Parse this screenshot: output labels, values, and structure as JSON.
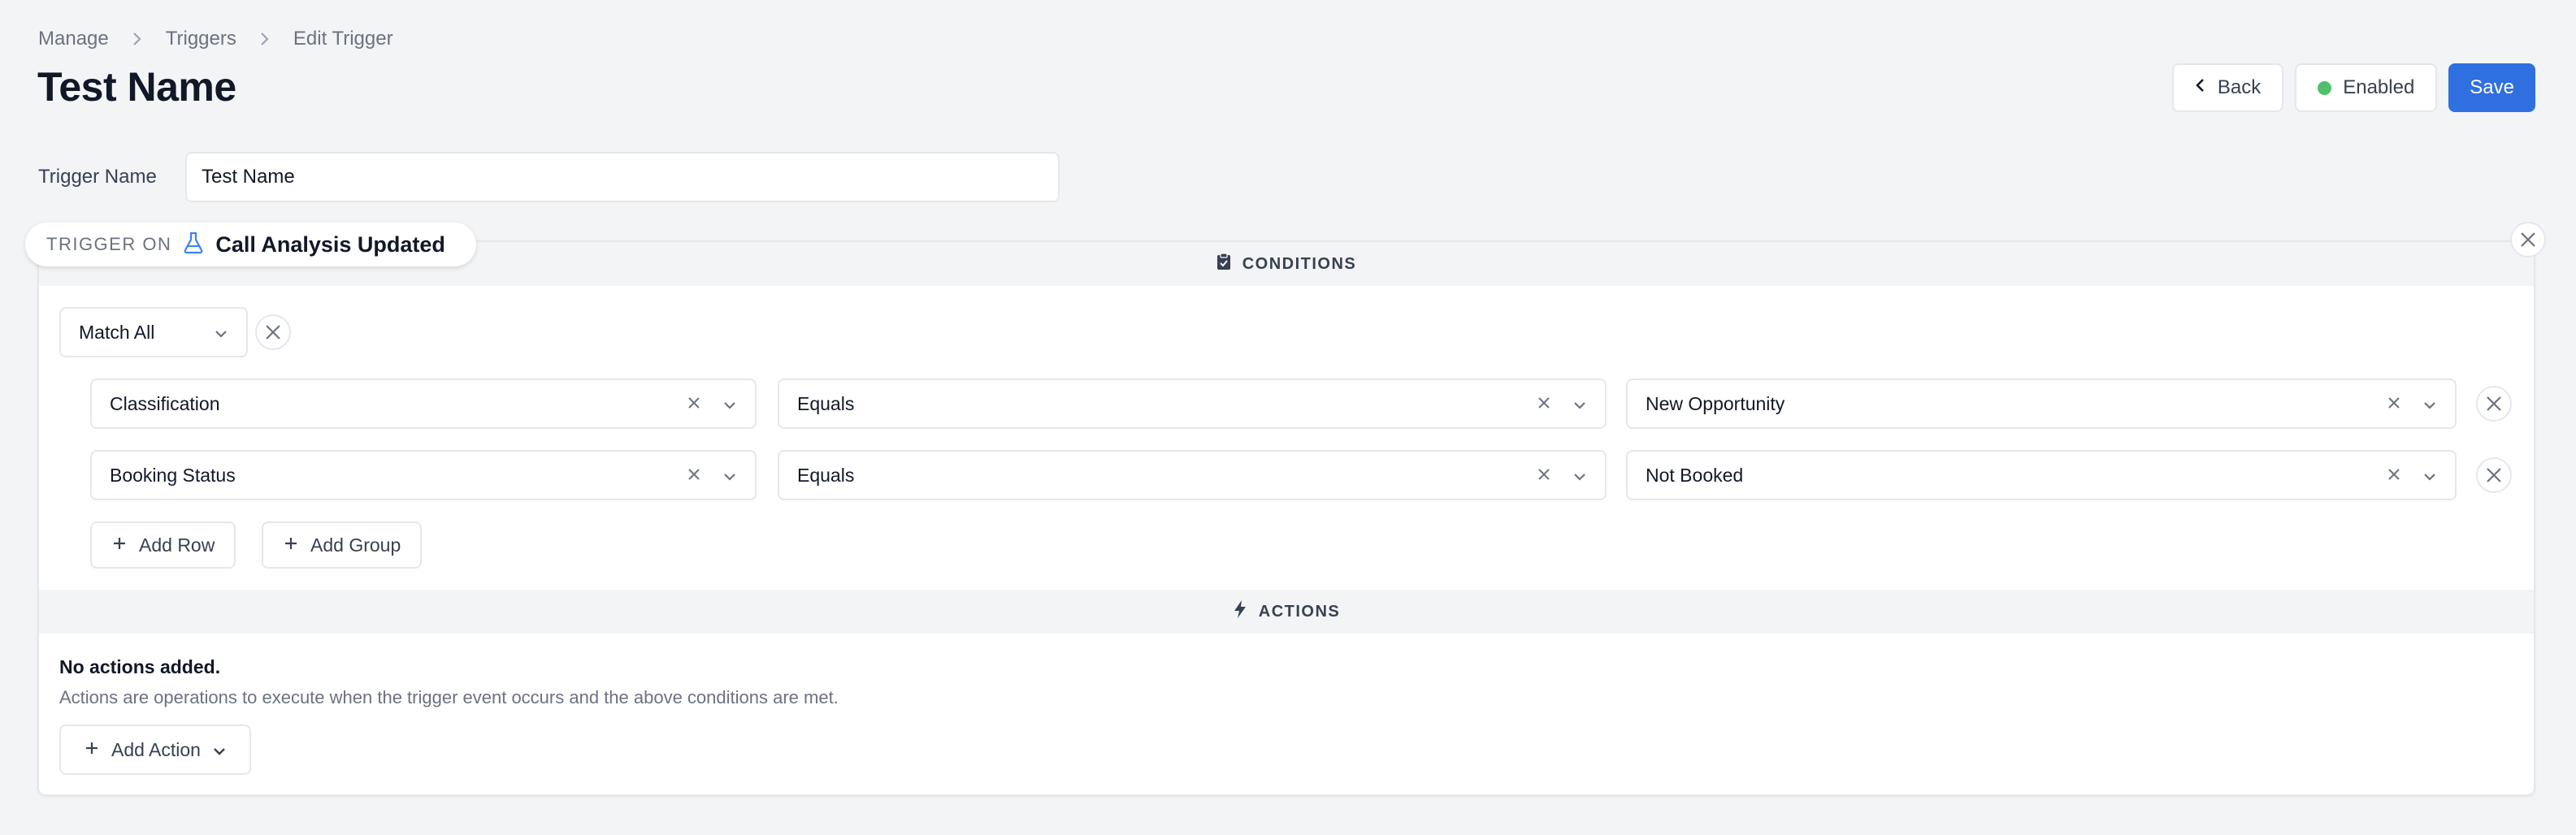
{
  "breadcrumb": [
    "Manage",
    "Triggers",
    "Edit Trigger"
  ],
  "page_title": "Test Name",
  "header": {
    "back_label": "Back",
    "enabled_label": "Enabled",
    "save_label": "Save",
    "enabled_color": "#4ec16a",
    "primary_color": "#2f6fe0"
  },
  "trigger_name": {
    "label": "Trigger Name",
    "value": "Test Name"
  },
  "trigger_on": {
    "label": "TRIGGER ON",
    "value": "Call Analysis Updated",
    "icon": "flask-icon"
  },
  "conditions": {
    "title": "CONDITIONS",
    "icon": "clipboard-check-icon",
    "match_mode": "Match All",
    "rows": [
      {
        "field": "Classification",
        "operator": "Equals",
        "value": "New Opportunity"
      },
      {
        "field": "Booking Status",
        "operator": "Equals",
        "value": "Not Booked"
      }
    ],
    "add_row_label": "Add Row",
    "add_group_label": "Add Group"
  },
  "actions": {
    "title": "ACTIONS",
    "icon": "bolt-icon",
    "empty_title": "No actions added.",
    "empty_description": "Actions are operations to execute when the trigger event occurs and the above conditions are met.",
    "add_action_label": "Add Action"
  }
}
